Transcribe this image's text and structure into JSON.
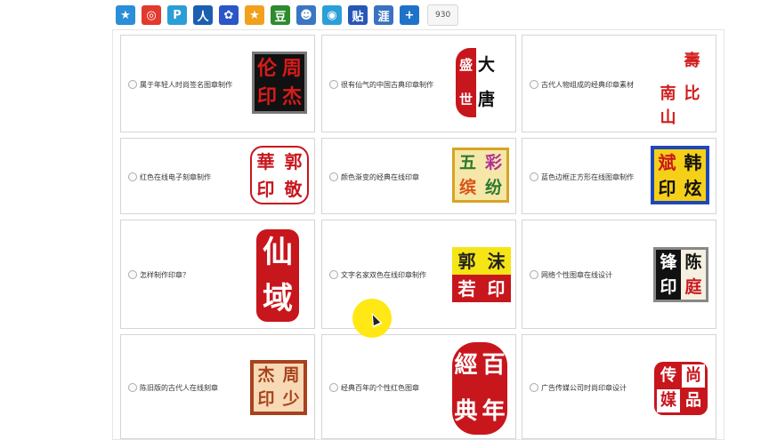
{
  "share_bar": {
    "buttons": [
      {
        "icon": "qzone-star-icon",
        "glyph": "★",
        "color": "#2a8fd8"
      },
      {
        "icon": "weibo-icon",
        "glyph": "◎",
        "color": "#e23a2e"
      },
      {
        "icon": "tencent-weibo-icon",
        "glyph": "P",
        "color": "#2b9ed6"
      },
      {
        "icon": "renren-icon",
        "glyph": "人",
        "color": "#1b5fb0"
      },
      {
        "icon": "baidu-paw-icon",
        "glyph": "✿",
        "color": "#2c55c8"
      },
      {
        "icon": "pengyou-star-icon",
        "glyph": "★",
        "color": "#f1a11c"
      },
      {
        "icon": "douban-icon",
        "glyph": "豆",
        "color": "#2e8b2e"
      },
      {
        "icon": "kaixin-icon",
        "glyph": "☻",
        "color": "#3a76c4"
      },
      {
        "icon": "qq-circle-icon",
        "glyph": "◉",
        "color": "#2c9fd9"
      },
      {
        "icon": "tieba-icon",
        "glyph": "贴",
        "color": "#2657b8"
      },
      {
        "icon": "huaban-icon",
        "glyph": "涯",
        "color": "#3a72c0"
      },
      {
        "icon": "more-plus-icon",
        "glyph": "+",
        "color": "#1e73c8"
      }
    ],
    "count": "930"
  },
  "cards": [
    {
      "label": "属于年轻人时尚签名图章制作",
      "seal": [
        "伦",
        "周",
        "印",
        "杰"
      ],
      "bg": "#111111",
      "fg": "#d81b1b",
      "border": "#777777"
    },
    {
      "label": "很有仙气的中国古典印章制作",
      "seal": [
        "盛",
        "大",
        "世",
        "唐"
      ],
      "bg": "#c8161d",
      "fg": "#ffffff",
      "border": "#c8161d"
    },
    {
      "label": "古代人物组成的经典印章素材",
      "seal": [
        "南",
        "壽",
        "山",
        "比"
      ],
      "bg": "#ffffff",
      "fg": "#d11c1c",
      "border": "#ffffff"
    },
    {
      "label": "红色在线电子刻章制作",
      "seal": [
        "華",
        "郭",
        "印",
        "敬"
      ],
      "bg": "#ffffff",
      "fg": "#c8161d",
      "border": "#c8161d"
    },
    {
      "label": "颜色渐变的经典在线印章",
      "seal": [
        "五",
        "彩",
        "缤",
        "纷"
      ],
      "bg": "#f5e7a8",
      "fg": "#2d7a2d",
      "border": "#d7a423"
    },
    {
      "label": "蓝色边框正方形在线图章制作",
      "seal": [
        "斌",
        "韩",
        "印",
        "炫"
      ],
      "bg": "#f5d018",
      "fg": "#c8161d",
      "border": "#1f47b8"
    },
    {
      "label": "怎样制作印章？",
      "seal": [
        "仙",
        "",
        "域",
        ""
      ],
      "bg": "#c8161d",
      "fg": "#ffffff",
      "border": "#c8161d"
    },
    {
      "label": "文字名家双色在线印章制作",
      "seal": [
        "郭",
        "沫",
        "若",
        "印"
      ],
      "bg": "#f5e515",
      "fg": "#222222",
      "border": "#f5e515"
    },
    {
      "label": "网络个性图章在线设计",
      "seal": [
        "锋",
        "陈",
        "印",
        "庭"
      ],
      "bg": "#111111",
      "fg": "#ffffff",
      "border": "#888888"
    },
    {
      "label": "陈旧版的古代人在线刻章",
      "seal": [
        "杰",
        "周",
        "印",
        "少"
      ],
      "bg": "#f7d9b5",
      "fg": "#a8421e",
      "border": "#a8421e"
    },
    {
      "label": "经典百年的个性红色图章",
      "seal": [
        "經",
        "百",
        "典",
        "年"
      ],
      "bg": "#c8161d",
      "fg": "#ffffff",
      "border": "#c8161d"
    },
    {
      "label": "广告传媒公司时尚印章设计",
      "seal": [
        "传",
        "尚",
        "媒",
        "品"
      ],
      "bg": "#c8161d",
      "fg": "#ffffff",
      "border": "#c8161d"
    }
  ]
}
